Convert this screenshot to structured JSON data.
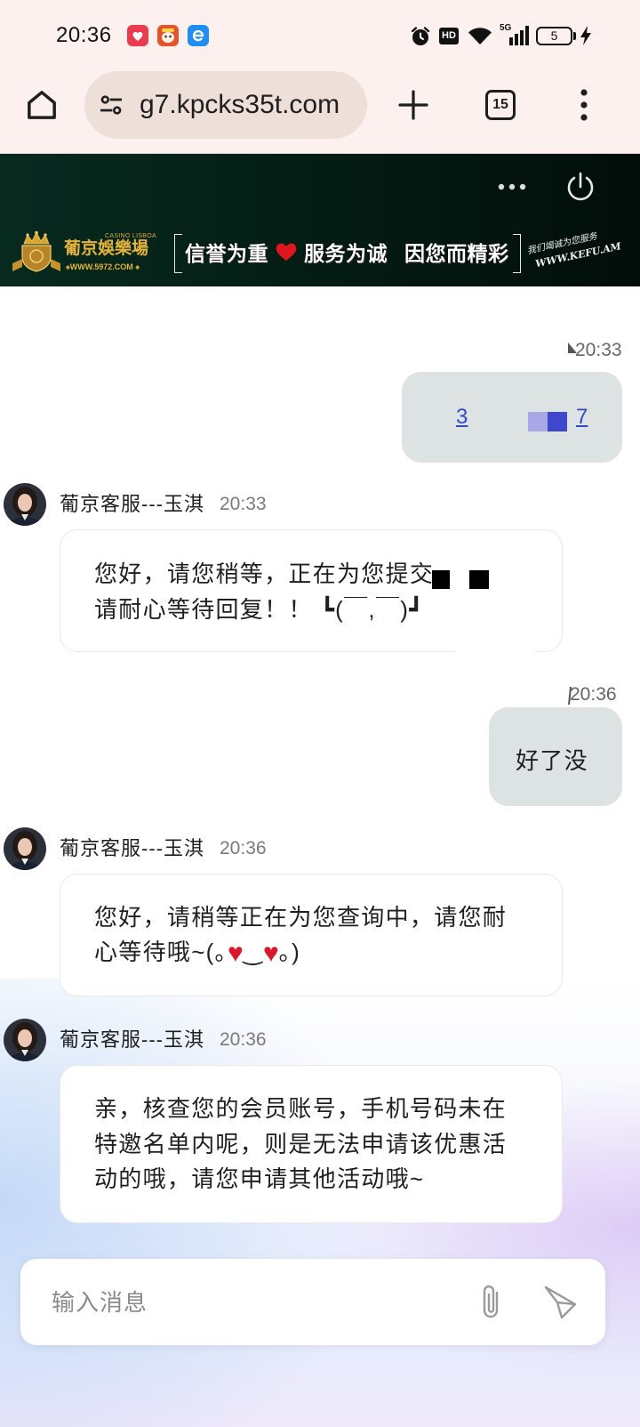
{
  "status_bar": {
    "time": "20:36",
    "hd_label": "HD",
    "network_label": "5G",
    "battery_level": "5",
    "app_icons": [
      "app-icon-red",
      "app-icon-orange",
      "app-icon-blue"
    ],
    "indicator_icons": [
      "alarm-icon",
      "hd-icon",
      "wifi-icon",
      "signal-icon",
      "battery-icon",
      "charging-icon"
    ]
  },
  "browser": {
    "url": "g7.kpcks35t.com",
    "tab_count": "15",
    "icons": [
      "home-icon",
      "site-settings-icon",
      "new-tab-icon",
      "tab-switcher-icon",
      "more-menu-icon"
    ]
  },
  "banner": {
    "icons": [
      "more-dots-icon",
      "power-icon",
      "crown-logo-icon",
      "heart-icon"
    ],
    "logo_caption": "CASINO LISBOA",
    "logo_name": "葡京娛樂場",
    "logo_site": "WWW.5972.COM",
    "slogan": [
      "信誉为重",
      "服务为诚",
      "因您而精彩"
    ],
    "tagline": "我们竭诚为您服务",
    "tagline_site": "WWW.KEFU.AM"
  },
  "messages": [
    {
      "time": "20:33",
      "content": [
        "3",
        "7"
      ]
    },
    {
      "sender": "葡京客服---玉淇",
      "time": "20:33",
      "lines": [
        "您好，请您稍等，正在为您提交",
        "请耐心等待回复！！ ┗(￣,￣)┛"
      ]
    },
    {
      "time": "20:36",
      "text": "好了没"
    },
    {
      "sender": "葡京客服---玉淇",
      "time": "20:36",
      "lines": [
        [
          {
            "text": "您好，请稍等正在为您查询中，请您耐"
          }
        ],
        [
          {
            "text": "心等待哦~(｡"
          },
          {
            "text": "♥",
            "color": "#d8192b"
          },
          {
            "text": "‿"
          },
          {
            "text": "♥",
            "color": "#d8192b"
          },
          {
            "text": "｡)"
          }
        ]
      ]
    },
    {
      "sender": "葡京客服---玉淇",
      "time": "20:36",
      "lines": [
        "亲，核查您的会员账号，手机号码未在",
        "特邀名单内呢，则是无法申请该优惠活",
        "动的哦，请您申请其他活动哦~"
      ]
    }
  ],
  "composer": {
    "placeholder": "输入消息",
    "icons": [
      "attach-icon",
      "send-icon"
    ]
  },
  "colors": {
    "status_bar_bg": "#fcf1ee",
    "url_pill_bg": "#eedfd9",
    "user_bubble": "#dde2e3",
    "banner_gold": "#e5b43c",
    "link_blue": "#3448c8"
  }
}
